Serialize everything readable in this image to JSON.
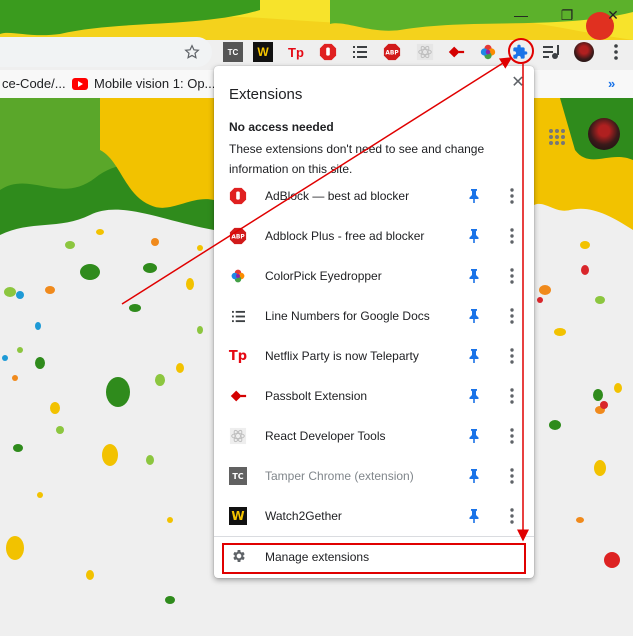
{
  "window": {
    "minimize_glyph": "—",
    "restore_glyph": "❐",
    "close_glyph": "✕"
  },
  "toolbar": {
    "star_icon": "star-icon",
    "extension_icons": [
      {
        "name": "tamper-chrome-icon",
        "glyph": "TC"
      },
      {
        "name": "watch2gether-icon",
        "glyph": "W"
      },
      {
        "name": "teleparty-icon",
        "glyph": "Tp"
      },
      {
        "name": "adblock-icon",
        "glyph": "✋"
      },
      {
        "name": "line-numbers-icon",
        "glyph": "≡"
      },
      {
        "name": "adblock-plus-icon",
        "glyph": "ABP"
      },
      {
        "name": "react-devtools-icon",
        "glyph": "⚛"
      },
      {
        "name": "passbolt-icon",
        "glyph": "◆"
      },
      {
        "name": "colorpick-icon",
        "glyph": "●"
      }
    ],
    "puzzle_icon": "puzzle-icon",
    "media_icon": "media-control-icon",
    "profile_icon": "avatar",
    "menu_icon": "kebab-menu-icon"
  },
  "bookmarks": {
    "items": [
      {
        "label": "ce-Code/..."
      },
      {
        "label": "Mobile vision 1: Op..."
      }
    ],
    "overflow": "»"
  },
  "popup": {
    "title": "Extensions",
    "close": "✕",
    "section_heading": "No access needed",
    "section_description": "These extensions don't need to see and change information on this site.",
    "extensions": [
      {
        "name": "AdBlock — best ad blocker",
        "icon": "adblock-icon",
        "glyph": "✋",
        "color": "#e02020",
        "pinned": true,
        "dim": false
      },
      {
        "name": "Adblock Plus - free ad blocker",
        "icon": "adblock-plus-icon",
        "glyph": "ABP",
        "color": "#d11a1a",
        "pinned": true,
        "dim": false
      },
      {
        "name": "ColorPick Eyedropper",
        "icon": "colorpick-icon",
        "glyph": "●",
        "color": "#ff9800",
        "pinned": true,
        "dim": false
      },
      {
        "name": "Line Numbers for Google Docs",
        "icon": "line-numbers-icon",
        "glyph": "≡",
        "color": "#3c4043",
        "pinned": true,
        "dim": false
      },
      {
        "name": "Netflix Party is now Teleparty",
        "icon": "teleparty-icon",
        "glyph": "Tp",
        "color": "#e50914",
        "pinned": true,
        "dim": false
      },
      {
        "name": "Passbolt Extension",
        "icon": "passbolt-icon",
        "glyph": "◆",
        "color": "#d40101",
        "pinned": true,
        "dim": false
      },
      {
        "name": "React Developer Tools",
        "icon": "react-devtools-icon",
        "glyph": "⚛",
        "color": "#bdbdbd",
        "pinned": true,
        "dim": false
      },
      {
        "name": "Tamper Chrome (extension)",
        "icon": "tamper-chrome-icon",
        "glyph": "TC",
        "color": "#616161",
        "pinned": true,
        "dim": true
      },
      {
        "name": "Watch2Gether",
        "icon": "watch2gether-icon",
        "glyph": "W",
        "color": "#111111",
        "pinned": true,
        "dim": false
      }
    ],
    "manage_label": "Manage extensions"
  },
  "colors": {
    "pin_blue": "#1a73e8",
    "annotation_red": "#e00000",
    "puzzle_blue": "#1a73e8"
  }
}
